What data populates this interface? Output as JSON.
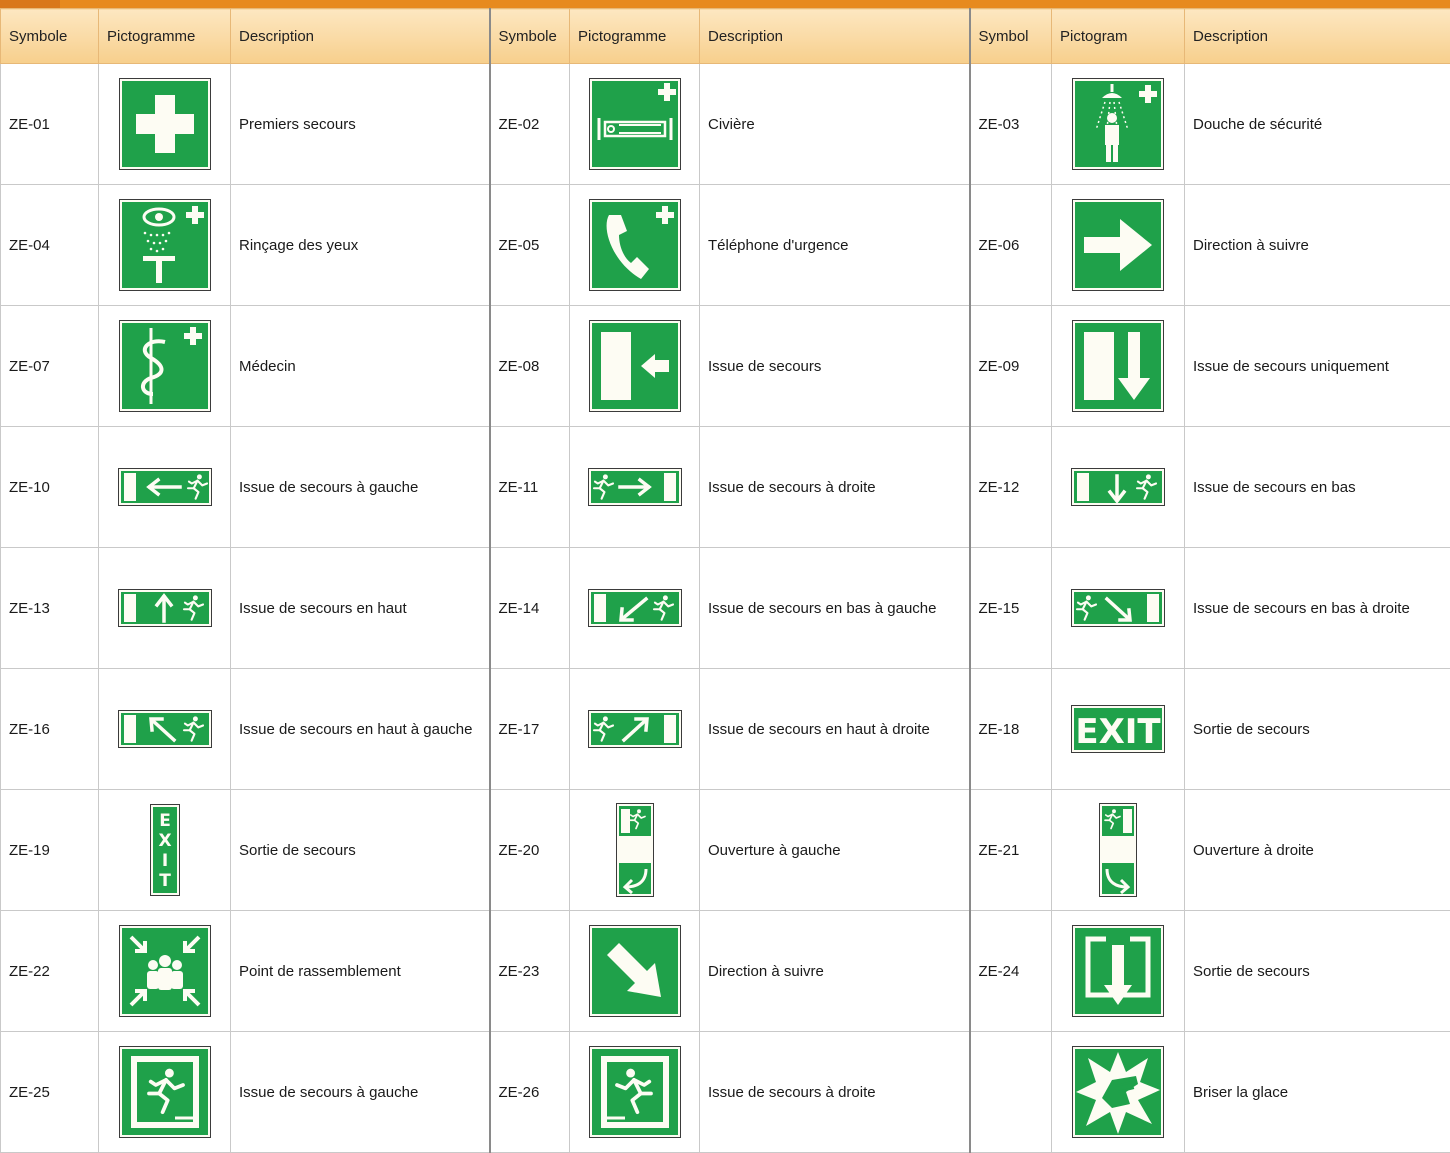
{
  "headers": [
    "Symbole",
    "Pictogramme",
    "Description",
    "Symbole",
    "Pictogramme",
    "Description",
    "Symbol",
    "Pictogram",
    "Description"
  ],
  "rows": [
    [
      {
        "code": "ZE-01",
        "icon": "first-aid-icon",
        "desc": "Premiers secours"
      },
      {
        "code": "ZE-02",
        "icon": "stretcher-icon",
        "desc": "Civière"
      },
      {
        "code": "ZE-03",
        "icon": "safety-shower-icon",
        "desc": "Douche de sécurité"
      }
    ],
    [
      {
        "code": "ZE-04",
        "icon": "eye-wash-icon",
        "desc": "Rinçage des yeux"
      },
      {
        "code": "ZE-05",
        "icon": "emergency-phone-icon",
        "desc": "Téléphone d'urgence"
      },
      {
        "code": "ZE-06",
        "icon": "arrow-right-icon",
        "desc": "Direction à suivre"
      }
    ],
    [
      {
        "code": "ZE-07",
        "icon": "doctor-icon",
        "desc": "Médecin"
      },
      {
        "code": "ZE-08",
        "icon": "exit-door-arrow-left-icon",
        "desc": "Issue de secours"
      },
      {
        "code": "ZE-09",
        "icon": "exit-door-arrow-down-icon",
        "desc": "Issue de secours uniquement"
      }
    ],
    [
      {
        "code": "ZE-10",
        "icon": "exit-left-icon",
        "desc": "Issue de secours à gauche"
      },
      {
        "code": "ZE-11",
        "icon": "exit-right-icon",
        "desc": "Issue de secours à droite"
      },
      {
        "code": "ZE-12",
        "icon": "exit-down-icon",
        "desc": "Issue de secours en bas"
      }
    ],
    [
      {
        "code": "ZE-13",
        "icon": "exit-up-icon",
        "desc": "Issue de secours en haut"
      },
      {
        "code": "ZE-14",
        "icon": "exit-down-left-icon",
        "desc": "Issue de secours en bas à gauche"
      },
      {
        "code": "ZE-15",
        "icon": "exit-down-right-icon",
        "desc": "Issue de secours en bas à droite"
      }
    ],
    [
      {
        "code": "ZE-16",
        "icon": "exit-up-left-icon",
        "desc": "Issue de secours en haut à gauche"
      },
      {
        "code": "ZE-17",
        "icon": "exit-up-right-icon",
        "desc": "Issue de secours en haut à droite"
      },
      {
        "code": "ZE-18",
        "icon": "exit-text-icon",
        "desc": "Sortie de secours"
      }
    ],
    [
      {
        "code": "ZE-19",
        "icon": "exit-vertical-text-icon",
        "desc": "Sortie de secours"
      },
      {
        "code": "ZE-20",
        "icon": "door-open-left-icon",
        "desc": "Ouverture à gauche"
      },
      {
        "code": "ZE-21",
        "icon": "door-open-right-icon",
        "desc": "Ouverture à droite"
      }
    ],
    [
      {
        "code": "ZE-22",
        "icon": "assembly-point-icon",
        "desc": "Point de rassemblement"
      },
      {
        "code": "ZE-23",
        "icon": "arrow-down-right-icon",
        "desc": "Direction à suivre"
      },
      {
        "code": "ZE-24",
        "icon": "exit-box-arrow-down-icon",
        "desc": "Sortie de secours"
      }
    ],
    [
      {
        "code": "ZE-25",
        "icon": "running-man-left-icon",
        "desc": "Issue de secours à gauche"
      },
      {
        "code": "ZE-26",
        "icon": "running-man-right-icon",
        "desc": "Issue de secours à droite"
      },
      {
        "code": "",
        "icon": "break-glass-icon",
        "desc": "Briser la glace"
      }
    ]
  ],
  "colors": {
    "sign_green": "#1fa14a",
    "sign_white": "#fdfcf3",
    "header_orange": "#e78a1e"
  }
}
